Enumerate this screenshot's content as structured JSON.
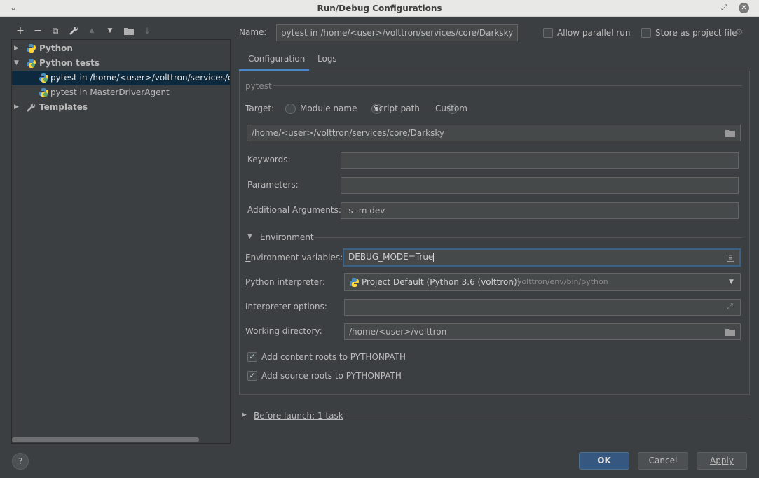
{
  "window": {
    "title": "Run/Debug Configurations"
  },
  "toolbar": {
    "add": "+",
    "remove": "−",
    "copy": "⧉",
    "edit": "🔧",
    "move_up": "▲",
    "move_down": "▼",
    "folder": "📁",
    "sort": "↓"
  },
  "tree": {
    "items": [
      {
        "label": "Python",
        "expanded": false
      },
      {
        "label": "Python tests",
        "expanded": true
      },
      {
        "label": "pytest in /home/<user>/volttron/services/core/"
      },
      {
        "label": "pytest in MasterDriverAgent"
      },
      {
        "label": "Templates",
        "expanded": false
      }
    ]
  },
  "header": {
    "name_label": "Name:",
    "name_value": "pytest in /home/<user>/volttron/services/core/Darksky",
    "allow_parallel_label": "Allow parallel run",
    "store_project_label": "Store as project file"
  },
  "tabs": [
    {
      "label": "Configuration",
      "active": true
    },
    {
      "label": "Logs",
      "active": false
    }
  ],
  "config": {
    "section": "pytest",
    "target_label": "Target:",
    "targets": [
      "Module name",
      "Script path",
      "Custom"
    ],
    "selected_target": "Script path",
    "script_path": "/home/<user>/volttron/services/core/Darksky",
    "keywords_label": "Keywords:",
    "keywords_value": "",
    "parameters_label": "Parameters:",
    "parameters_value": "",
    "additional_label": "Additional Arguments:",
    "additional_value": "-s -m dev",
    "environment_label": "Environment",
    "env_vars_label": "Environment variables:",
    "env_vars_value": "DEBUG_MODE=True",
    "interpreter_label": "Python interpreter:",
    "interpreter_value": "Project Default (Python 3.6 (volttron))",
    "interpreter_path": "~/volttron/env/bin/python",
    "interp_options_label": "Interpreter options:",
    "interp_options_value": "",
    "working_dir_label": "Working directory:",
    "working_dir_value": "/home/<user>/volttron",
    "content_roots_label": "Add content roots to PYTHONPATH",
    "source_roots_label": "Add source roots to PYTHONPATH",
    "before_launch_label": "Before launch: 1 task"
  },
  "footer": {
    "help": "?",
    "ok": "OK",
    "cancel": "Cancel",
    "apply": "Apply"
  },
  "colors": {
    "background": "#3c3f41",
    "selection": "#0d293e",
    "accent": "#4a88c7",
    "primary_button": "#365880"
  }
}
